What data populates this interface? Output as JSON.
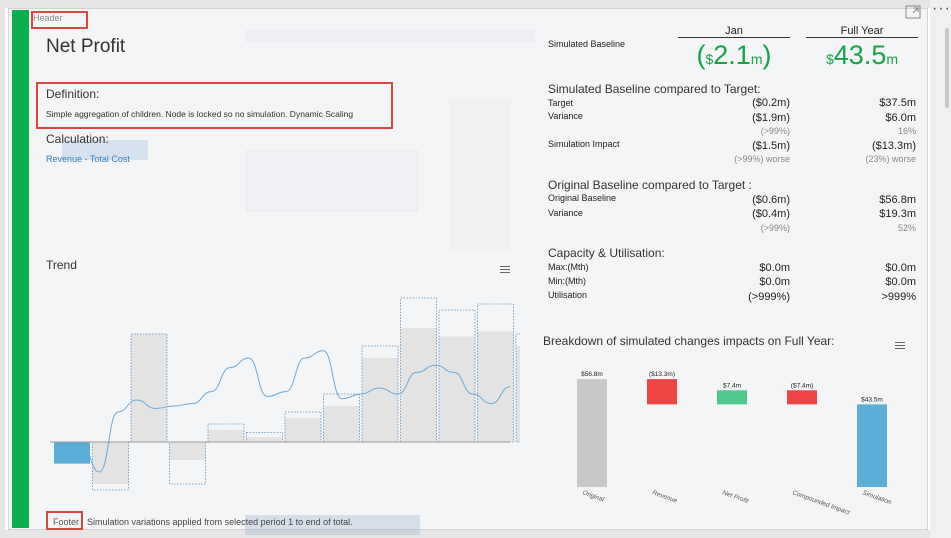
{
  "header_tag": "Header",
  "footer_tag": "Footer",
  "footer_text": "Simulation variations applied from selected period 1 to end of total.",
  "title": "Net Profit",
  "definition": {
    "label": "Definition:",
    "text": "Simple aggregation of children. Node is locked so no simulation. Dynamic Scaling"
  },
  "calculation": {
    "label": "Calculation:",
    "link": "Revenue - Total Cost"
  },
  "trend_label": "Trend",
  "simulated_baseline": {
    "label": "Simulated Baseline",
    "jan_header": "Jan",
    "fy_header": "Full Year",
    "jan_prefix": "$",
    "jan_value": "2.1",
    "jan_unit": "m",
    "jan_open": "(",
    "jan_close": ")",
    "fy_prefix": "$",
    "fy_value": "43.5",
    "fy_unit": "m"
  },
  "vs_target": {
    "title": "Simulated Baseline compared to Target:",
    "target_label": "Target",
    "target_jan": "($0.2m)",
    "target_fy": "$37.5m",
    "variance_label": "Variance",
    "variance_jan": "($1.9m)",
    "variance_fy": "$6.0m",
    "variance_jan_pct": "(>99%)",
    "variance_fy_pct": "16%",
    "impact_label": "Simulation Impact",
    "impact_jan": "($1.5m)",
    "impact_fy": "($13.3m)",
    "impact_jan_pct": "(>99%) worse",
    "impact_fy_pct": "(23%) worse"
  },
  "original_vs_target": {
    "title": "Original Baseline compared to Target :",
    "baseline_label": "Original Baseline",
    "baseline_jan": "($0.6m)",
    "baseline_fy": "$56.8m",
    "variance_label": "Variance",
    "variance_jan": "($0.4m)",
    "variance_fy": "$19.3m",
    "variance_jan_pct": "(>99%)",
    "variance_fy_pct": "52%"
  },
  "capacity": {
    "title": "Capacity & Utilisation:",
    "max_label": "Max:(Mth)",
    "max_jan": "$0.0m",
    "max_fy": "$0.0m",
    "min_label": "Min:(Mth)",
    "min_jan": "$0.0m",
    "min_fy": "$0.0m",
    "util_label": "Utilisation",
    "util_jan": "(>999%)",
    "util_fy": ">999%"
  },
  "breakdown_title": "Breakdown of simulated changes impacts on Full Year:",
  "chart_data": [
    {
      "type": "bar",
      "name": "trend",
      "title": "Trend",
      "note": "bars with dotted simulated outlines and a line overlay; no axis labels shown",
      "baseline": [
        -18,
        -35,
        90,
        -15,
        10,
        4,
        20,
        30,
        70,
        95,
        88,
        92,
        80
      ],
      "simulated": [
        -18,
        -40,
        90,
        -35,
        15,
        8,
        25,
        40,
        80,
        120,
        110,
        115,
        90
      ],
      "line": [
        -15,
        0,
        -25,
        25,
        35,
        28,
        30,
        32,
        42,
        62,
        70,
        38,
        42,
        70,
        76,
        36,
        40,
        45,
        40,
        58,
        64,
        58,
        40,
        32,
        46
      ]
    },
    {
      "type": "bar",
      "name": "breakdown",
      "categories": [
        "Original",
        "Revenue",
        "Net Profit",
        "Compounded Impact",
        "Simulation"
      ],
      "values": [
        56.8,
        -13.3,
        7.4,
        -7.4,
        43.5
      ],
      "labels": [
        "$56.8m",
        "($13.3m)",
        "$7.4m",
        "($7.4m)",
        "$43.5m"
      ],
      "colors": [
        "#c8c8c8",
        "#ef4444",
        "#4ec98b",
        "#ef4444",
        "#5aaed8"
      ]
    }
  ]
}
